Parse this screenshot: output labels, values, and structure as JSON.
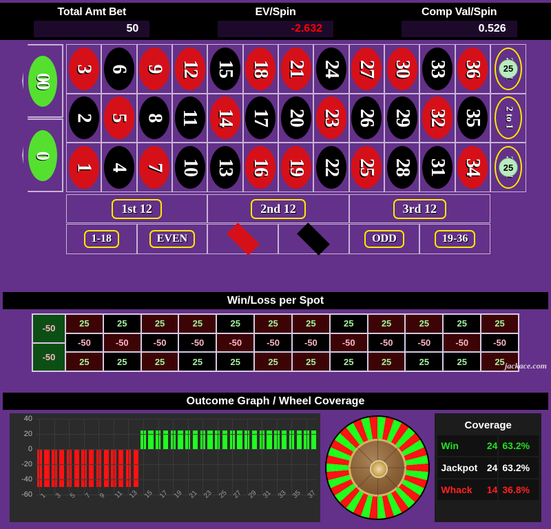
{
  "stats": [
    {
      "label": "Total Amt Bet",
      "value": "50",
      "negative": false
    },
    {
      "label": "EV/Spin",
      "value": "-2.632",
      "negative": true
    },
    {
      "label": "Comp Val/Spin",
      "value": "0.526",
      "negative": false
    }
  ],
  "table": {
    "zeros": [
      {
        "label": "00"
      },
      {
        "label": "0"
      }
    ],
    "numbers": [
      {
        "n": "3",
        "color": "red"
      },
      {
        "n": "6",
        "color": "black"
      },
      {
        "n": "9",
        "color": "red"
      },
      {
        "n": "12",
        "color": "red"
      },
      {
        "n": "15",
        "color": "black"
      },
      {
        "n": "18",
        "color": "red"
      },
      {
        "n": "21",
        "color": "red"
      },
      {
        "n": "24",
        "color": "black"
      },
      {
        "n": "27",
        "color": "red"
      },
      {
        "n": "30",
        "color": "red"
      },
      {
        "n": "33",
        "color": "black"
      },
      {
        "n": "36",
        "color": "red"
      },
      {
        "n": "2",
        "color": "black"
      },
      {
        "n": "5",
        "color": "red"
      },
      {
        "n": "8",
        "color": "black"
      },
      {
        "n": "11",
        "color": "black"
      },
      {
        "n": "14",
        "color": "red"
      },
      {
        "n": "17",
        "color": "black"
      },
      {
        "n": "20",
        "color": "black"
      },
      {
        "n": "23",
        "color": "red"
      },
      {
        "n": "26",
        "color": "black"
      },
      {
        "n": "29",
        "color": "black"
      },
      {
        "n": "32",
        "color": "red"
      },
      {
        "n": "35",
        "color": "black"
      },
      {
        "n": "1",
        "color": "red"
      },
      {
        "n": "4",
        "color": "black"
      },
      {
        "n": "7",
        "color": "red"
      },
      {
        "n": "10",
        "color": "black"
      },
      {
        "n": "13",
        "color": "black"
      },
      {
        "n": "16",
        "color": "red"
      },
      {
        "n": "19",
        "color": "red"
      },
      {
        "n": "22",
        "color": "black"
      },
      {
        "n": "25",
        "color": "red"
      },
      {
        "n": "28",
        "color": "black"
      },
      {
        "n": "31",
        "color": "black"
      },
      {
        "n": "34",
        "color": "red"
      }
    ],
    "column_bets": [
      {
        "label": "2 to 1",
        "chip": "25"
      },
      {
        "label": "2 to 1",
        "chip": null
      },
      {
        "label": "2 to 1",
        "chip": "25"
      }
    ],
    "dozens": [
      {
        "label": "1st 12"
      },
      {
        "label": "2nd 12"
      },
      {
        "label": "3rd 12"
      }
    ],
    "outside": [
      {
        "label": "1-18",
        "kind": "text"
      },
      {
        "label": "EVEN",
        "kind": "text"
      },
      {
        "label": "RED",
        "kind": "diamond-red"
      },
      {
        "label": "BLACK",
        "kind": "diamond-black"
      },
      {
        "label": "ODD",
        "kind": "text"
      },
      {
        "label": "19-36",
        "kind": "text"
      }
    ]
  },
  "winloss": {
    "title": "Win/Loss per Spot",
    "zero_values": [
      "-50",
      "-50"
    ],
    "values": [
      "25",
      "25",
      "25",
      "25",
      "25",
      "25",
      "25",
      "25",
      "25",
      "25",
      "25",
      "25",
      "-50",
      "-50",
      "-50",
      "-50",
      "-50",
      "-50",
      "-50",
      "-50",
      "-50",
      "-50",
      "-50",
      "-50",
      "25",
      "25",
      "25",
      "25",
      "25",
      "25",
      "25",
      "25",
      "25",
      "25",
      "25",
      "25"
    ],
    "watermark": "jackace.com"
  },
  "outcome": {
    "title": "Outcome Graph / Wheel Coverage"
  },
  "chart_data": {
    "type": "bar",
    "title": "Outcome Graph / Wheel Coverage",
    "xlabel": "",
    "ylabel": "",
    "ylim": [
      -60,
      40
    ],
    "yticks": [
      40,
      20,
      0,
      -20,
      -40,
      -60
    ],
    "grid": true,
    "legend": "none",
    "x": [
      1,
      2,
      3,
      4,
      5,
      6,
      7,
      8,
      9,
      10,
      11,
      12,
      13,
      14,
      15,
      16,
      17,
      18,
      19,
      20,
      21,
      22,
      23,
      24,
      25,
      26,
      27,
      28,
      29,
      30,
      31,
      32,
      33,
      34,
      35,
      36,
      37,
      38
    ],
    "xtick_labels": [
      "1",
      "3",
      "5",
      "7",
      "9",
      "11",
      "13",
      "15",
      "17",
      "19",
      "21",
      "23",
      "25",
      "27",
      "29",
      "31",
      "33",
      "35",
      "37"
    ],
    "values": [
      -50,
      -50,
      -50,
      -50,
      -50,
      -50,
      -50,
      -50,
      -50,
      -50,
      -50,
      -50,
      -50,
      -50,
      25,
      25,
      25,
      25,
      25,
      25,
      25,
      25,
      25,
      25,
      25,
      25,
      25,
      25,
      25,
      25,
      25,
      25,
      25,
      25,
      25,
      25,
      25,
      25
    ],
    "colors": {
      "positive": "#1eff1e",
      "negative": "#ff1212"
    }
  },
  "coverage": {
    "title": "Coverage",
    "rows": [
      {
        "label": "Win",
        "count": "24",
        "pct": "63.2%"
      },
      {
        "label": "Jackpot",
        "count": "24",
        "pct": "63.2%"
      },
      {
        "label": "Whack",
        "count": "14",
        "pct": "36.8%"
      }
    ]
  }
}
